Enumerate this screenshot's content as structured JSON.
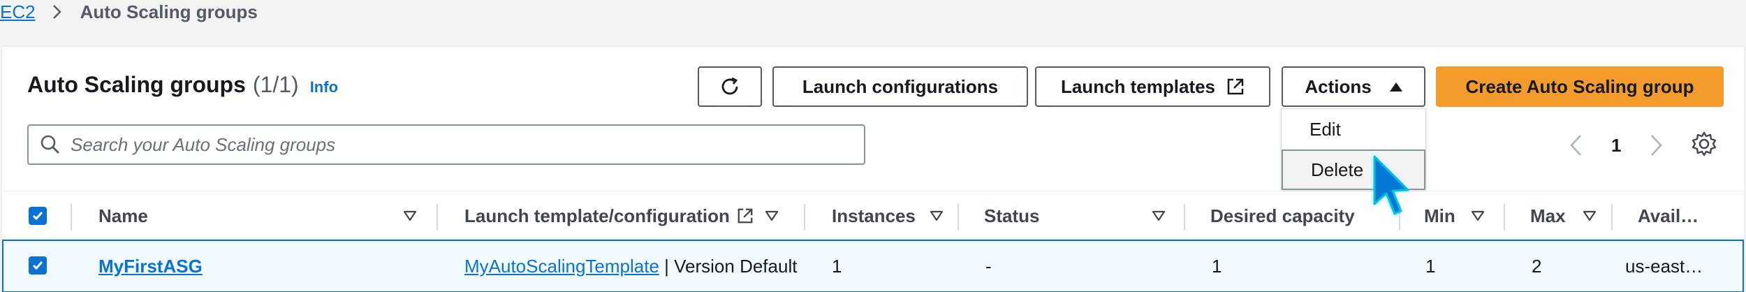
{
  "breadcrumb": {
    "root": "EC2",
    "current": "Auto Scaling groups"
  },
  "panel": {
    "title": "Auto Scaling groups",
    "count": "(1/1)",
    "info": "Info"
  },
  "toolbar": {
    "refresh_icon": "refresh-icon",
    "launch_configurations": "Launch configurations",
    "launch_templates": "Launch templates",
    "actions": "Actions",
    "create": "Create Auto Scaling group"
  },
  "actions_menu": {
    "items": [
      "Edit",
      "Delete"
    ],
    "hovered": "Delete"
  },
  "search": {
    "placeholder": "Search your Auto Scaling groups",
    "value": ""
  },
  "pagination": {
    "page": "1"
  },
  "table": {
    "columns": [
      "Name",
      "Launch template/configuration",
      "Instances",
      "Status",
      "Desired capacity",
      "Min",
      "Max",
      "Avail…"
    ],
    "rows": [
      {
        "selected": true,
        "name": "MyFirstASG",
        "launch_template": "MyAutoScalingTemplate",
        "launch_version": " | Version Default",
        "instances": "1",
        "status": "-",
        "desired_capacity": "1",
        "min": "1",
        "max": "2",
        "availability": "us-east…"
      }
    ]
  },
  "colors": {
    "link": "#0972d3",
    "primary_button": "#f39c2c",
    "selected_row": "#f1faff",
    "cursor": "#00c4e0"
  }
}
